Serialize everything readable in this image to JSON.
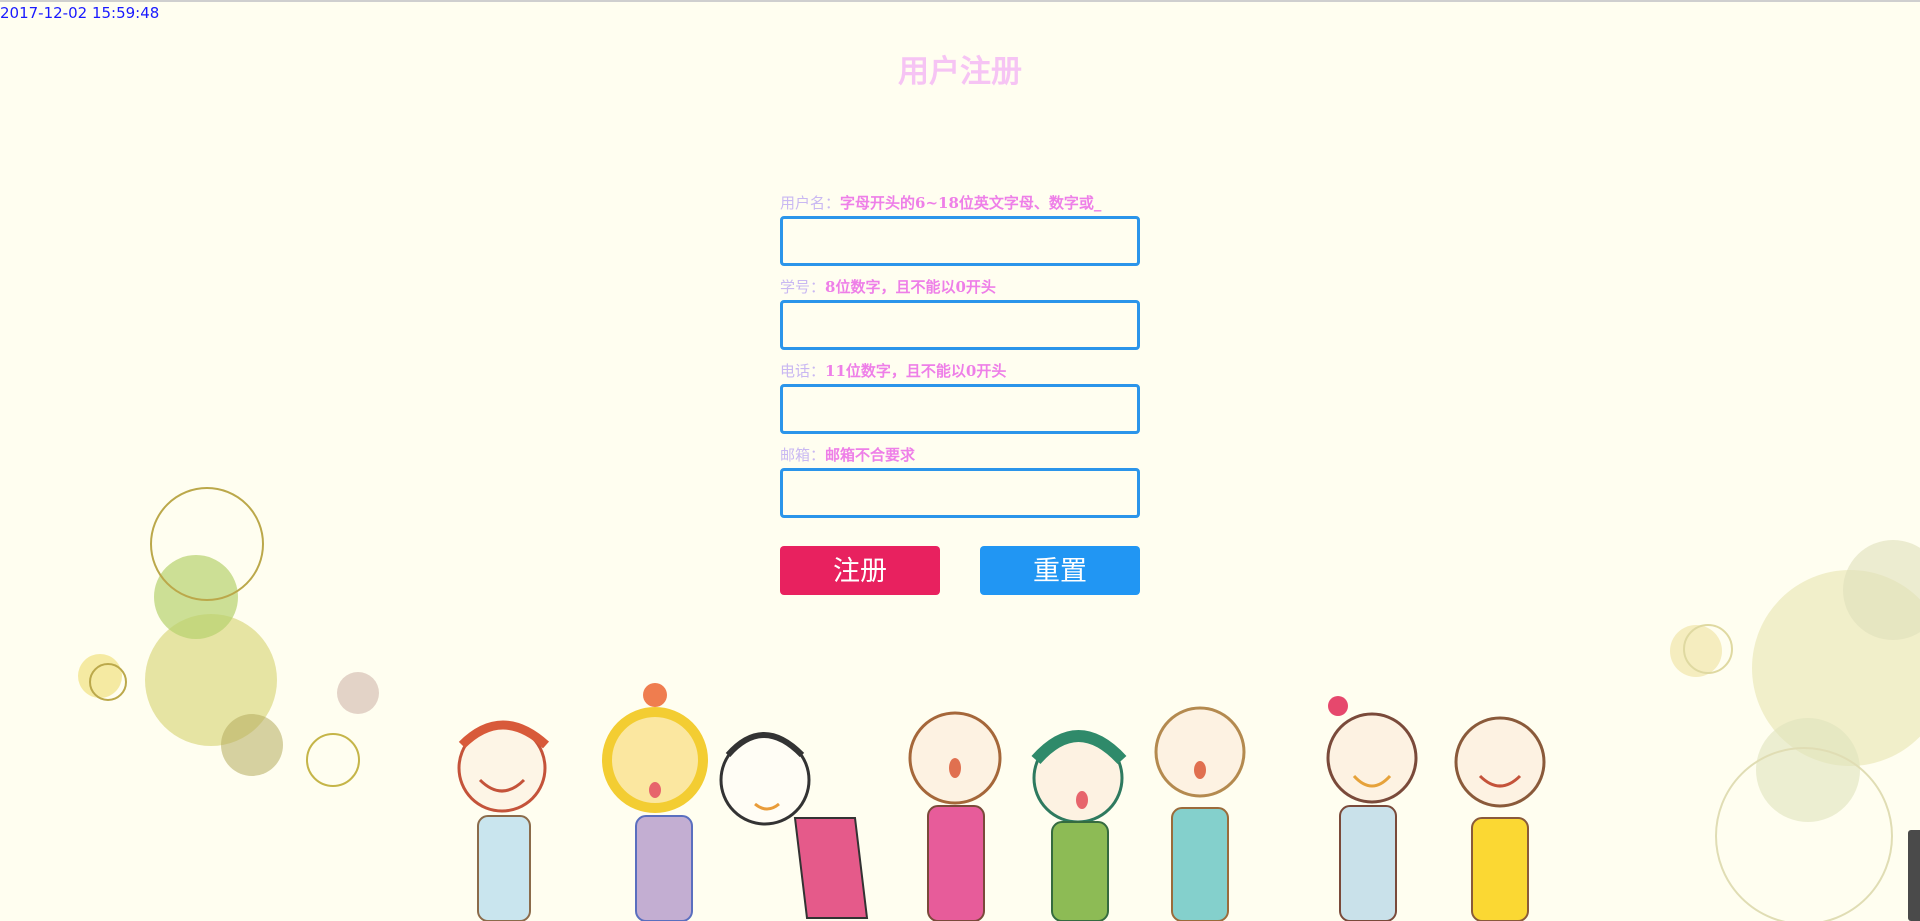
{
  "header": {
    "datetime": "2017-12-02 15:59:48",
    "title": "用户注册"
  },
  "form": {
    "fields": [
      {
        "label": "用户名：",
        "hint": "字母开头的6~18位英文字母、数字或_"
      },
      {
        "label": "学号：",
        "hint": "8位数字，且不能以0开头"
      },
      {
        "label": "电话：",
        "hint": "11位数字，且不能以0开头"
      },
      {
        "label": "邮箱：",
        "hint": "邮箱不合要求"
      }
    ],
    "register_label": "注册",
    "reset_label": "重置"
  },
  "colors": {
    "background": "#fffef0",
    "title": "#f6c4f4",
    "hint": "#ee7fe8",
    "input_border": "#2b95ea",
    "register_button": "#e8215f",
    "reset_button": "#2196f3"
  }
}
